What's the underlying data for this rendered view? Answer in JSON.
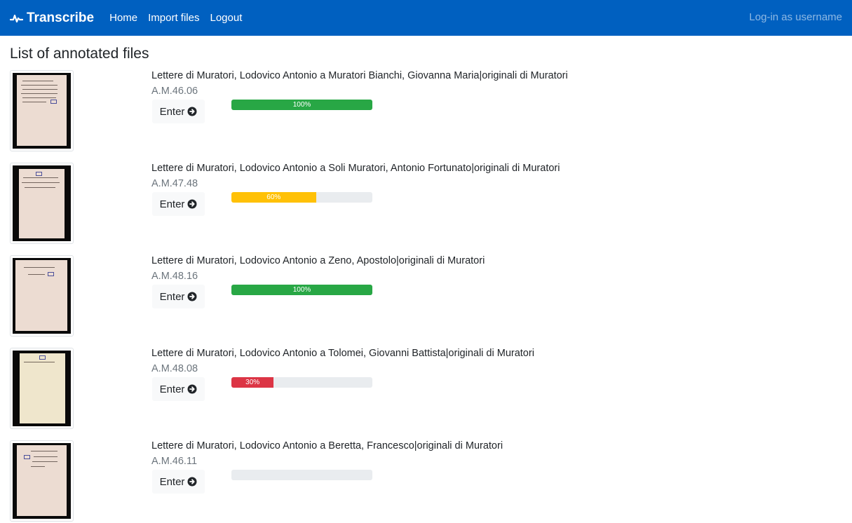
{
  "navbar": {
    "brand": "Transcribe",
    "brand_icon": "pulse-logo-icon",
    "links": [
      "Home",
      "Import files",
      "Logout"
    ],
    "login_text": "Log-in as username",
    "background": "#0060c0"
  },
  "page": {
    "title": "List of annotated files"
  },
  "files": [
    {
      "title": "Lettere di Muratori, Lodovico Antonio a Muratori Bianchi, Giovanna Maria|originali di Muratori",
      "code": "A.M.46.06",
      "button": "Enter",
      "progress": 100,
      "progress_label": "100%",
      "progress_color": "#28a745"
    },
    {
      "title": "Lettere di Muratori, Lodovico Antonio a Soli Muratori, Antonio Fortunato|originali di Muratori",
      "code": "A.M.47.48",
      "button": "Enter",
      "progress": 60,
      "progress_label": "60%",
      "progress_color": "#ffc107"
    },
    {
      "title": "Lettere di Muratori, Lodovico Antonio a Zeno, Apostolo|originali di Muratori",
      "code": "A.M.48.16",
      "button": "Enter",
      "progress": 100,
      "progress_label": "100%",
      "progress_color": "#28a745"
    },
    {
      "title": "Lettere di Muratori, Lodovico Antonio a Tolomei, Giovanni Battista|originali di Muratori",
      "code": "A.M.48.08",
      "button": "Enter",
      "progress": 30,
      "progress_label": "30%",
      "progress_color": "#dc3545"
    },
    {
      "title": "Lettere di Muratori, Lodovico Antonio a Beretta, Francesco|originali di Muratori",
      "code": "A.M.46.11",
      "button": "Enter",
      "progress": 0,
      "progress_label": "",
      "progress_color": "#6c757d"
    }
  ]
}
